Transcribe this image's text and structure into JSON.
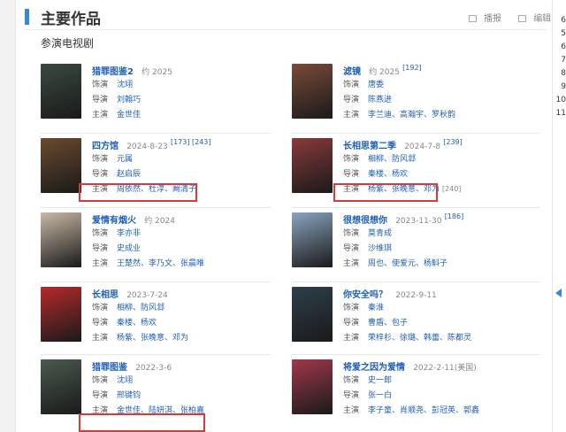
{
  "section": {
    "title": "主要作品",
    "subtitle": "参演电视剧"
  },
  "tools": [
    {
      "label": "播报",
      "icon": "speaker-icon"
    },
    {
      "label": "编辑",
      "icon": "edit-icon"
    }
  ],
  "right_panel": {
    "numbers": [
      "6",
      "5",
      "6",
      "7",
      "8",
      "9",
      "10",
      "11"
    ]
  },
  "labels": {
    "actor": "饰演",
    "director": "导演",
    "star": "主演"
  },
  "items": [
    {
      "title": "猎罪图鉴2",
      "meta": "约 2025",
      "refs": "",
      "actor": "沈翊",
      "director": "刘翰巧",
      "star": "金世佳",
      "poster": "#3a4a40"
    },
    {
      "title": "滤镜",
      "meta": "约 2025",
      "refs": "[192]",
      "actor": "唐委",
      "director": "陈燕进",
      "star": "李兰迪、高瀚宇、罗秋韵",
      "poster": "#7a4a3a"
    },
    {
      "title": "四方馆",
      "meta": "2024-8-23",
      "refs": "[173] [243]",
      "actor": "元属",
      "director": "赵启辰",
      "star": "周依然、杜淳、阚清子",
      "poster": "#6b4a2e"
    },
    {
      "title": "长相思第二季",
      "meta": "2024-7-8",
      "refs": "[239]",
      "actor": "相柳、防风邶",
      "director": "秦楼、杨欢",
      "star": "杨紫、张晚意、邓为",
      "poster": "#8a3a3a",
      "after": "[240]"
    },
    {
      "title": "爱情有烟火",
      "meta": "约 2024",
      "refs": "",
      "actor": "李亦非",
      "director": "史成业",
      "star": "王楚然、李乃文、张晨唯",
      "poster": "#c9b9a6"
    },
    {
      "title": "很想很想你",
      "meta": "2023-11-30",
      "refs": "[186]",
      "actor": "莫青成",
      "director": "沙维琪",
      "star": "周也、使爱元、杨斛子",
      "poster": "#8aa4c0"
    },
    {
      "title": "长相思",
      "meta": "2023-7-24",
      "refs": "",
      "actor": "相柳、防风邶",
      "director": "秦楼、杨欢",
      "star": "杨紫、张晚意、邓为",
      "poster": "#b52a2a"
    },
    {
      "title": "你安全吗？",
      "meta": "2022-9-11",
      "refs": "",
      "actor": "秦淮",
      "director": "曹盾、包子",
      "star": "荣梓杉、徐璐、韩蕾、陈都灵",
      "poster": "#2f3f4a"
    },
    {
      "title": "猎罪图鉴",
      "meta": "2022-3-6",
      "refs": "",
      "actor": "沈翊",
      "director": "邢键钧",
      "star": "金世佳、陆妍淇、张柏嘉",
      "poster": "#4a5a4e"
    },
    {
      "title": "将爱之因为爱情",
      "meta": "2022-2-11(美国)",
      "refs": "",
      "actor": "史一郎",
      "director": "张一白",
      "star": "李子童、肖顺尧、彭冠英、郭鑫",
      "poster": "#a0384a"
    }
  ]
}
